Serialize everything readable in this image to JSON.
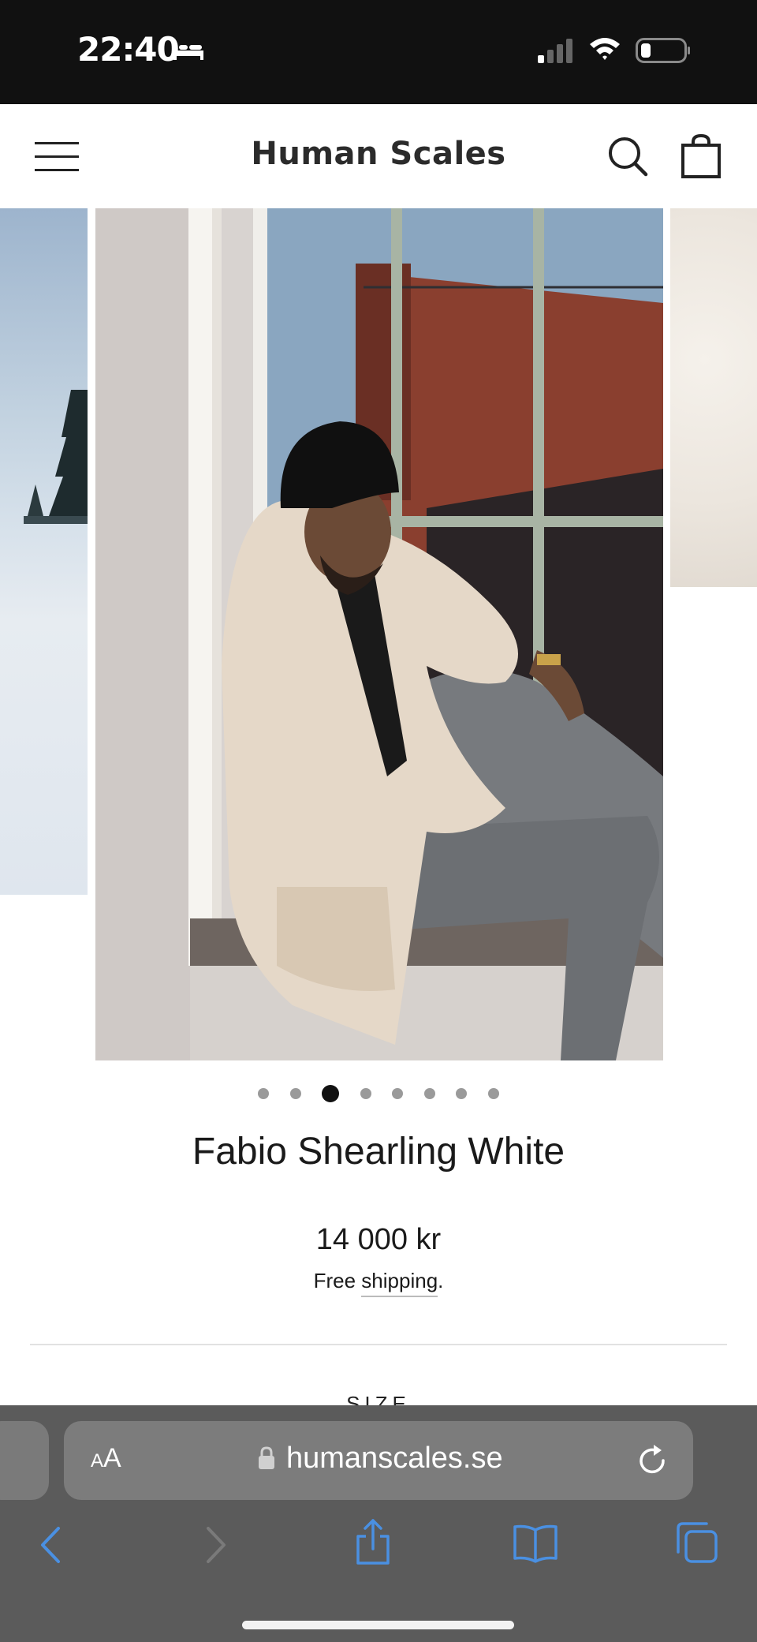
{
  "status_bar": {
    "time": "22:40",
    "icons": [
      "bed-icon",
      "signal-icon",
      "wifi-icon",
      "battery-icon"
    ]
  },
  "header": {
    "site_title": "Human Scales",
    "icons": [
      "menu-icon",
      "search-icon",
      "cart-icon"
    ]
  },
  "gallery": {
    "slide_count": 8,
    "active_index": 3
  },
  "product": {
    "title": "Fabio Shearling White",
    "price": "14 000 kr",
    "shipping_prefix": "Free ",
    "shipping_link": "shipping",
    "shipping_suffix": ".",
    "size_label": "SIZE"
  },
  "browser": {
    "aa_label_small": "A",
    "aa_label_large": "A",
    "url": "humanscales.se",
    "icons": [
      "lock-icon",
      "reload-icon",
      "back-icon",
      "forward-icon",
      "share-icon",
      "bookmarks-icon",
      "tabs-icon"
    ]
  },
  "colors": {
    "status_bar_bg": "#111111",
    "browser_accent": "#4a90e2",
    "browser_bar_bg": "#5b5b5b"
  }
}
